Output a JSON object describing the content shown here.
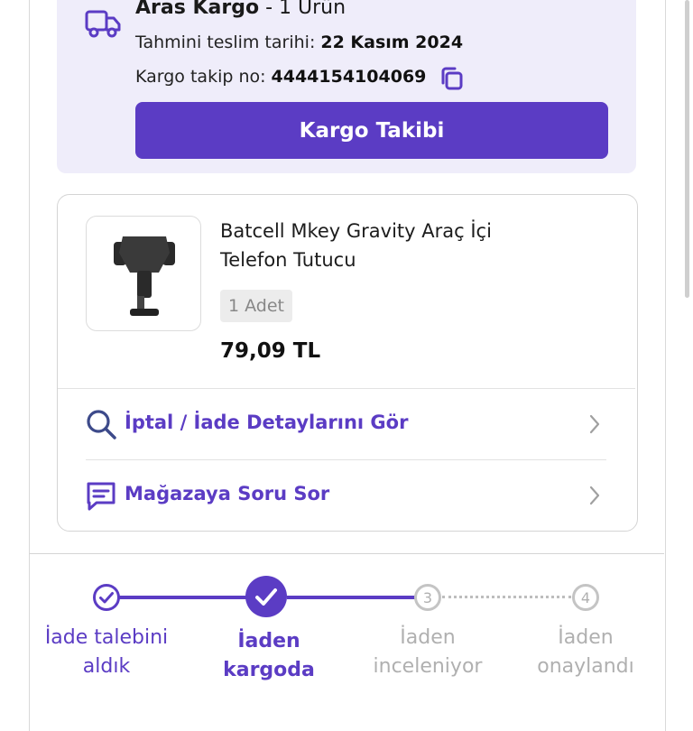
{
  "cargo": {
    "carrier": "Aras Kargo",
    "item_count": " - 1 Ürün",
    "delivery_label": "Tahmini teslim tarihi:",
    "delivery_date": "22 Kasım 2024",
    "tracking_label": "Kargo takip no:",
    "tracking_no": "4444154104069",
    "track_button": "Kargo Takibi"
  },
  "product": {
    "name": "Batcell Mkey Gravity Araç İçi Telefon Tutucu",
    "quantity": "1 Adet",
    "price": "79,09 TL"
  },
  "actions": [
    {
      "label": "İptal / İade Detaylarını Gör",
      "icon": "search-icon"
    },
    {
      "label": "Mağazaya Soru Sor",
      "icon": "chat-icon"
    }
  ],
  "progress": {
    "steps": [
      {
        "label": "İade talebini aldık",
        "state": "done",
        "marker": "check"
      },
      {
        "label": "İaden kargoda",
        "state": "current",
        "marker": "check"
      },
      {
        "label": "İaden inceleniyor",
        "state": "pending",
        "marker": "3"
      },
      {
        "label": "İaden onaylandı",
        "state": "pending",
        "marker": "4"
      }
    ]
  },
  "colors": {
    "accent": "#5b3cc4",
    "panel": "#efedfa",
    "muted": "#b0b0b0"
  }
}
